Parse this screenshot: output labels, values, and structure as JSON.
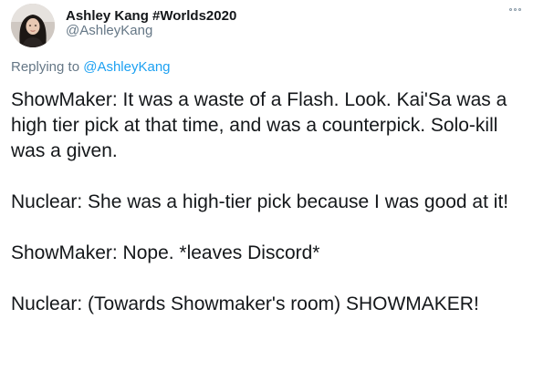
{
  "tweet": {
    "author_name": "Ashley Kang #Worlds2020",
    "author_handle": "@AshleyKang",
    "more_icon": "more-options-icon",
    "replying_prefix": "Replying to",
    "replying_handle": "@AshleyKang",
    "paragraphs": [
      "ShowMaker: It was a waste of a Flash. Look. Kai'Sa was a high tier pick at that time, and was a counterpick. Solo-kill was a given.",
      "Nuclear: She was a high-tier pick because I was good at it!",
      "ShowMaker: Nope. *leaves Discord*",
      "Nuclear: (Towards Showmaker's room) SHOWMAKER!"
    ]
  },
  "colors": {
    "text_primary": "#14171a",
    "text_secondary": "#657786",
    "link": "#1da1f2"
  }
}
